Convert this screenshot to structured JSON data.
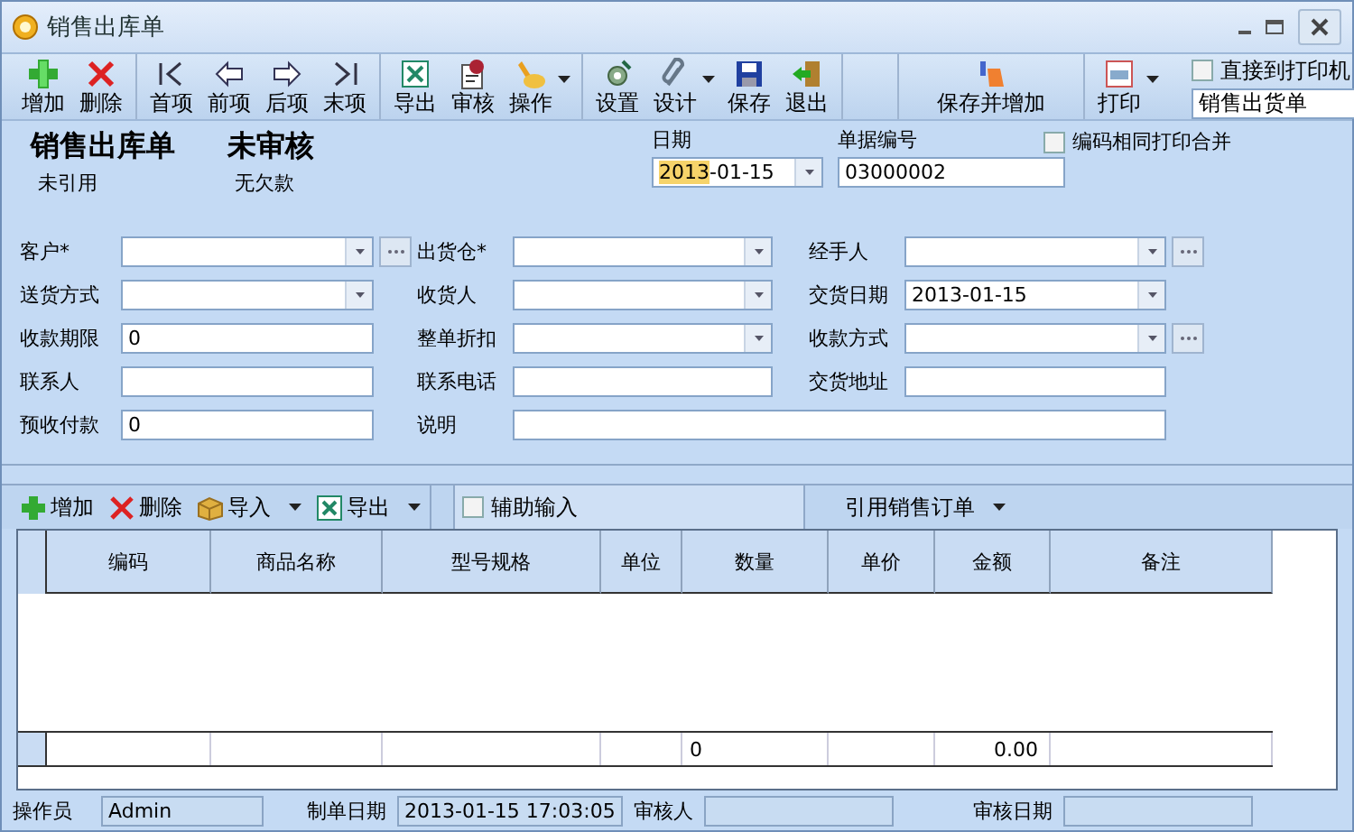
{
  "window": {
    "title": "销售出库单"
  },
  "toolbar": {
    "groups": [
      {
        "buttons": [
          {
            "label": "增加",
            "dropdown": false
          },
          {
            "label": "删除",
            "dropdown": false
          }
        ]
      },
      {
        "buttons": [
          {
            "label": "首项",
            "dropdown": false
          },
          {
            "label": "前项",
            "dropdown": false
          },
          {
            "label": "后项",
            "dropdown": false
          },
          {
            "label": "末项",
            "dropdown": false
          }
        ]
      },
      {
        "buttons": [
          {
            "label": "导出",
            "dropdown": false
          },
          {
            "label": "审核",
            "dropdown": false
          },
          {
            "label": "操作",
            "dropdown": true
          }
        ]
      },
      {
        "buttons": [
          {
            "label": "设置",
            "dropdown": false
          },
          {
            "label": "设计",
            "dropdown": true
          },
          {
            "label": "保存",
            "dropdown": false
          },
          {
            "label": "退出",
            "dropdown": false
          }
        ]
      },
      {
        "buttons": [
          {
            "label": "保存并增加",
            "dropdown": false
          }
        ]
      },
      {
        "buttons": [
          {
            "label": "打印",
            "dropdown": true
          }
        ]
      }
    ],
    "print_direct": {
      "label": "直接到打印机",
      "checked": false
    },
    "print_template": {
      "value": "销售出货单"
    }
  },
  "header": {
    "title": "销售出库单",
    "audit_status": "未审核",
    "reference_status": "未引用",
    "debt_status": "无欠款",
    "date": {
      "label": "日期",
      "value_selected": "2013",
      "value_rest": "-01-15"
    },
    "number": {
      "label": "单据编号",
      "value": "03000002"
    },
    "merge_print": {
      "label": "编码相同打印合并",
      "checked": false
    }
  },
  "form": {
    "rows": [
      [
        {
          "label": "客户*",
          "kind": "combo",
          "browse": true
        },
        {
          "label": "出货仓*",
          "kind": "combo",
          "browse": false
        },
        {
          "label": "经手人",
          "kind": "combo",
          "browse": true
        }
      ],
      [
        {
          "label": "送货方式",
          "kind": "combo",
          "browse": false
        },
        {
          "label": "收货人",
          "kind": "combo",
          "browse": false
        },
        {
          "label": "交货日期",
          "kind": "combo",
          "value": "2013-01-15",
          "browse": false
        }
      ],
      [
        {
          "label": "收款期限",
          "kind": "text",
          "value": "0",
          "browse": false
        },
        {
          "label": "整单折扣",
          "kind": "combo",
          "browse": false
        },
        {
          "label": "收款方式",
          "kind": "combo",
          "browse": true
        }
      ],
      [
        {
          "label": "联系人",
          "kind": "text",
          "browse": false
        },
        {
          "label": "联系电话",
          "kind": "text",
          "browse": false
        },
        {
          "label": "交货地址",
          "kind": "text",
          "browse": false
        }
      ],
      [
        {
          "label": "预收付款",
          "kind": "text",
          "value": "0",
          "browse": false
        },
        {
          "label": "说明",
          "kind": "wide",
          "browse": false
        }
      ]
    ]
  },
  "grid_toolbar": {
    "buttons": [
      {
        "label": "增加",
        "dropdown": false
      },
      {
        "label": "删除",
        "dropdown": false
      },
      {
        "label": "导入",
        "dropdown": true
      },
      {
        "label": "导出",
        "dropdown": true
      }
    ],
    "assist_input": {
      "label": "辅助输入",
      "checked": false
    },
    "reference": {
      "label": "引用销售订单"
    }
  },
  "table": {
    "columns": [
      "编码",
      "商品名称",
      "型号规格",
      "单位",
      "数量",
      "单价",
      "金额",
      "备注"
    ],
    "totals": {
      "quantity": "0",
      "amount": "0.00"
    }
  },
  "status_bar": [
    {
      "label": "操作员",
      "value": "Admin"
    },
    {
      "label": "制单日期",
      "value": "2013-01-15  17:03:05"
    },
    {
      "label": "审核人"
    },
    {
      "label": "审核日期"
    }
  ]
}
